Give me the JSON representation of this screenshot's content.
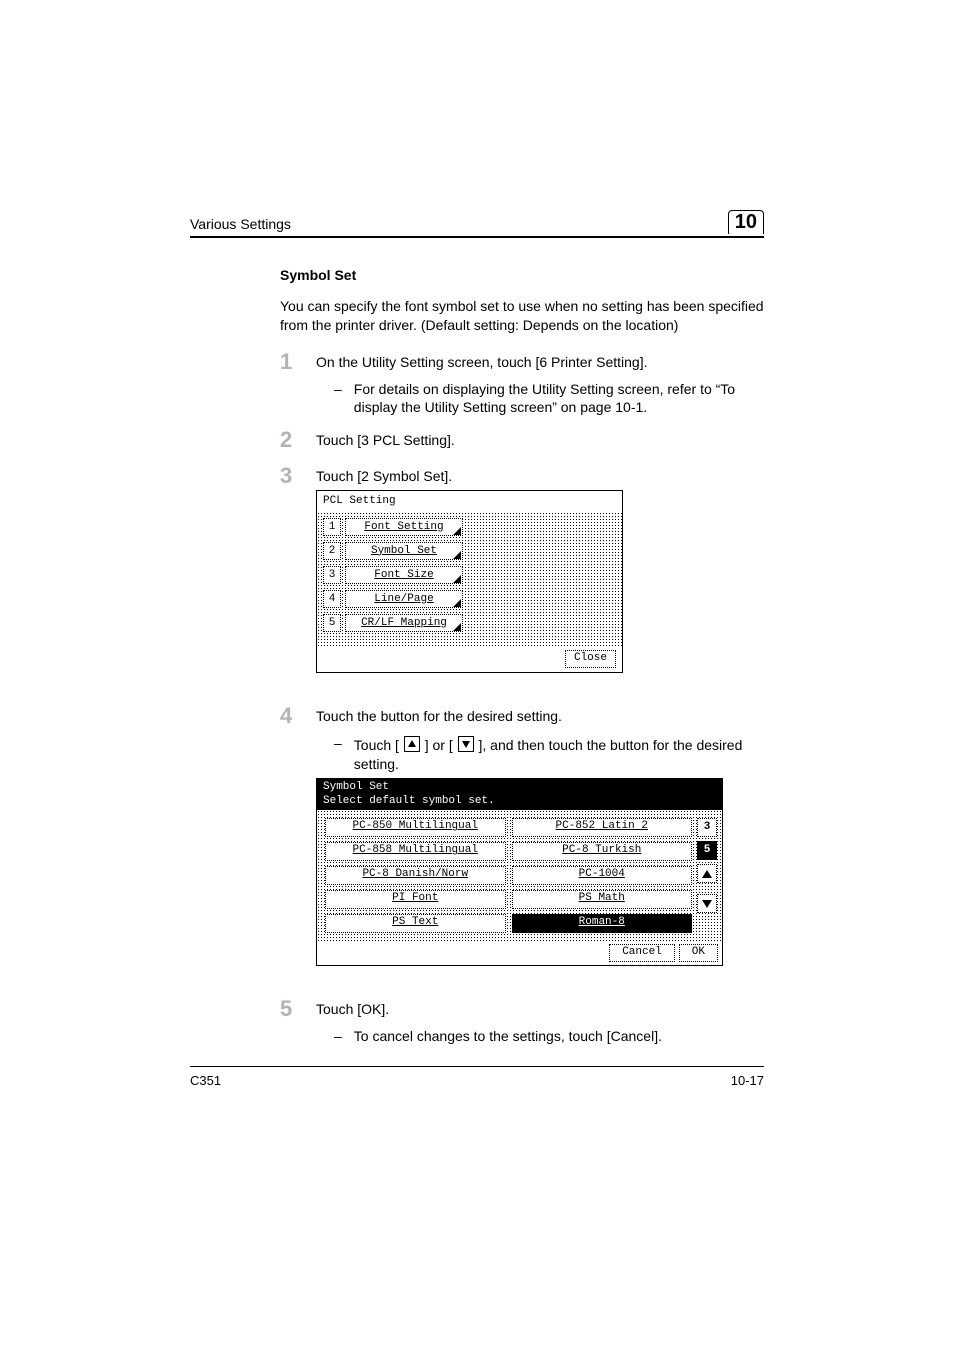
{
  "header": {
    "section_title": "Various Settings",
    "chapter_number": "10"
  },
  "section": {
    "heading": "Symbol Set",
    "intro": "You can specify the font symbol set to use when no setting has been specified from the printer driver. (Default setting: Depends on the location)"
  },
  "steps": {
    "s1": {
      "text": "On the Utility Setting screen, touch [6 Printer Setting].",
      "sub": "For details on displaying the Utility Setting screen, refer to “To display the Utility Setting screen” on page 10-1."
    },
    "s2": {
      "text": "Touch [3 PCL Setting]."
    },
    "s3": {
      "text": "Touch [2 Symbol Set]."
    },
    "s4": {
      "text": "Touch the button for the desired setting.",
      "sub_pre": "Touch [",
      "sub_mid": "] or [",
      "sub_post": "], and then touch the button for the desired setting."
    },
    "s5": {
      "text": "Touch [OK].",
      "sub": "To cancel changes to the settings, touch [Cancel]."
    }
  },
  "lcd1": {
    "title": "PCL Setting",
    "items": [
      {
        "num": "1",
        "label": "Font Setting"
      },
      {
        "num": "2",
        "label": "Symbol Set"
      },
      {
        "num": "3",
        "label": "Font Size"
      },
      {
        "num": "4",
        "label": "Line/Page"
      },
      {
        "num": "5",
        "label": "CR/LF Mapping"
      }
    ],
    "close": "Close"
  },
  "lcd2": {
    "title": "Symbol Set",
    "subtitle": "Select default symbol set.",
    "page_a": "3",
    "page_b": "5",
    "options": [
      [
        "PC-850 Multilingual",
        "PC-852 Latin 2"
      ],
      [
        "PC-858 Multilingual",
        "PC-8 Turkish"
      ],
      [
        "PC-8 Danish/Norw",
        "PC-1004"
      ],
      [
        "PI Font",
        "PS Math"
      ],
      [
        "PS Text",
        "Roman-8"
      ]
    ],
    "selected": "Roman-8",
    "cancel": "Cancel",
    "ok": "OK"
  },
  "footer": {
    "model": "C351",
    "page": "10-17"
  }
}
